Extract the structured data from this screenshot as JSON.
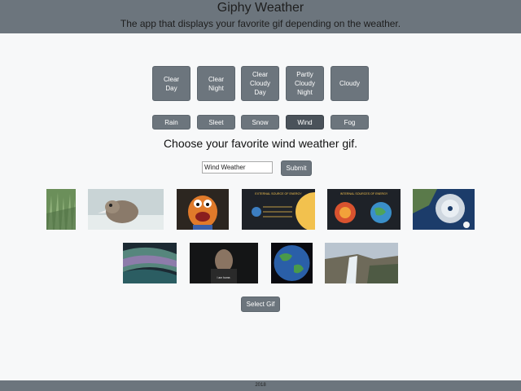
{
  "header": {
    "title": "Giphy Weather",
    "subtitle": "The app that displays your favorite gif depending on the weather."
  },
  "weather_buttons_row1": [
    {
      "label": "Clear\nDay"
    },
    {
      "label": "Clear\nNight"
    },
    {
      "label": "Clear\nCloudy\nDay"
    },
    {
      "label": "Partly\nCloudy\nNight"
    },
    {
      "label": "Cloudy"
    }
  ],
  "weather_buttons_row2": [
    {
      "label": "Rain"
    },
    {
      "label": "Sleet"
    },
    {
      "label": "Snow"
    },
    {
      "label": "Wind",
      "selected": true
    },
    {
      "label": "Fog"
    }
  ],
  "main": {
    "heading": "Choose your favorite wind weather gif.",
    "search_value": "Wind Weather",
    "submit_label": "Submit",
    "select_label": "Select Gif"
  },
  "gif_text": {
    "solar_1": "EXTERNAL SOURCE OF ENERGY",
    "solar_2": "INTERNAL SOURCES OF ENERGY",
    "caption": "I am home."
  },
  "footer": {
    "text": "2018"
  },
  "colors": {
    "button": "#6c757d",
    "button_active": "#4a525a",
    "header": "#6c757d",
    "background": "#f7f8f9"
  }
}
